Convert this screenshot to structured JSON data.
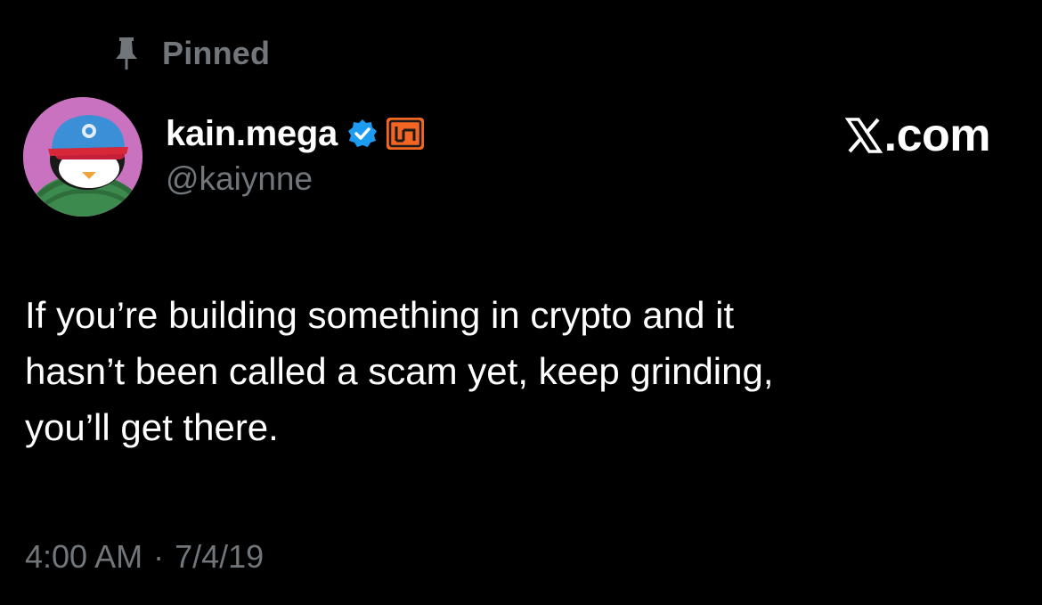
{
  "pinned": {
    "label": "Pinned",
    "icon": "pin-icon"
  },
  "author": {
    "display_name": "kain.mega",
    "handle": "@kaiynne",
    "verified_icon": "verified-badge-icon",
    "affiliate_icon": "affiliate-badge-icon",
    "avatar": "penguin-avatar"
  },
  "brand": {
    "text": ".com",
    "icon": "x-logo-icon"
  },
  "tweet": {
    "lines": [
      "If you’re building something in crypto and it",
      "hasn’t been called a scam yet, keep grinding,",
      "you’ll get there."
    ]
  },
  "meta": {
    "time": "4:00 AM",
    "separator": "·",
    "date": "7/4/19"
  },
  "colors": {
    "background": "#000000",
    "text_primary": "#ffffff",
    "text_secondary": "#71767b",
    "verified_blue": "#1d9bf0",
    "affiliate_orange": "#f26522",
    "avatar_bg": "#c973c0"
  }
}
